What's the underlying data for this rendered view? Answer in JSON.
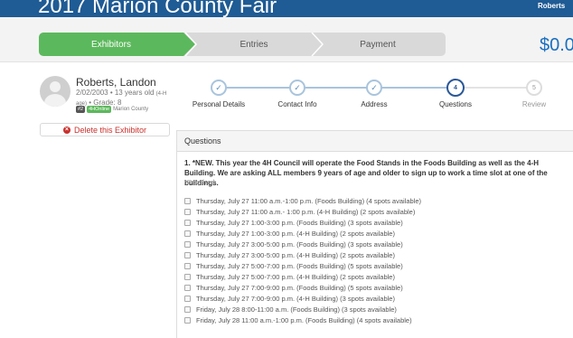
{
  "header": {
    "title": "2017 Marion County Fair",
    "user": "Roberts"
  },
  "wizard": {
    "steps": [
      "Exhibitors",
      "Entries",
      "Payment"
    ],
    "active_step": "Exhibitors",
    "total": "$0.0"
  },
  "exhibitor": {
    "name": "Roberts, Landon",
    "dob_age": "2/02/2003 • 13 years old",
    "age_note_a": "(4-H",
    "age_note_b": "age)",
    "grade": "• Grade: 8",
    "badge_num": "#2",
    "badge_program": "4HOnline",
    "county": "Marion County",
    "delete_label": "Delete this Exhibitor"
  },
  "tracker": {
    "steps": [
      {
        "label": "Personal Details",
        "state": "done"
      },
      {
        "label": "Contact Info",
        "state": "done"
      },
      {
        "label": "Address",
        "state": "done"
      },
      {
        "label": "Questions",
        "state": "current",
        "number": "4"
      },
      {
        "label": "Review",
        "state": "future",
        "number": "5"
      }
    ],
    "check": "✓"
  },
  "questions": {
    "panel_title": "Questions",
    "q1_text": "1. *NEW. This year the 4H Council will operate the Food Stands in the Foods Building as well as the 4-H Building. We are asking ALL members 9 years of age and older to sign up to work a time slot at one of the buildings.",
    "q1_required": "*Required",
    "options": [
      "Thursday, July 27 11:00 a.m.-1:00 p.m. (Foods Building) (4 spots available)",
      "Thursday, July 27 11:00 a.m.- 1:00 p.m. (4-H Building) (2 spots available)",
      "Thursday, July 27 1:00-3:00 p.m. (Foods Building) (3 spots available)",
      "Thursday, July 27 1:00-3:00 p.m. (4-H Building) (2 spots available)",
      "Thursday, July 27 3:00-5:00 p.m. (Foods Building) (3 spots available)",
      "Thursday, July 27 3:00-5:00 p.m. (4-H Building) (2 spots available)",
      "Thursday, July 27 5:00-7:00 p.m. (Foods Building) (5 spots available)",
      "Thursday, July 27 5:00-7:00 p.m. (4-H Building) (2 spots available)",
      "Thursday, July 27 7:00-9:00 p.m. (Foods Building) (5 spots available)",
      "Thursday, July 27 7:00-9:00 p.m. (4-H Building) (3 spots available)",
      "Friday, July 28 8:00-11:00 a.m. (Foods Building) (3 spots available)",
      "Friday, July 28 11:00 a.m.-1:00 p.m. (Foods Building) (4 spots available)"
    ]
  },
  "colors": {
    "header_bg": "#1f5b94",
    "step_active": "#5cb85c",
    "tracker_current": "#2b5797",
    "delete_red": "#c9302c"
  }
}
